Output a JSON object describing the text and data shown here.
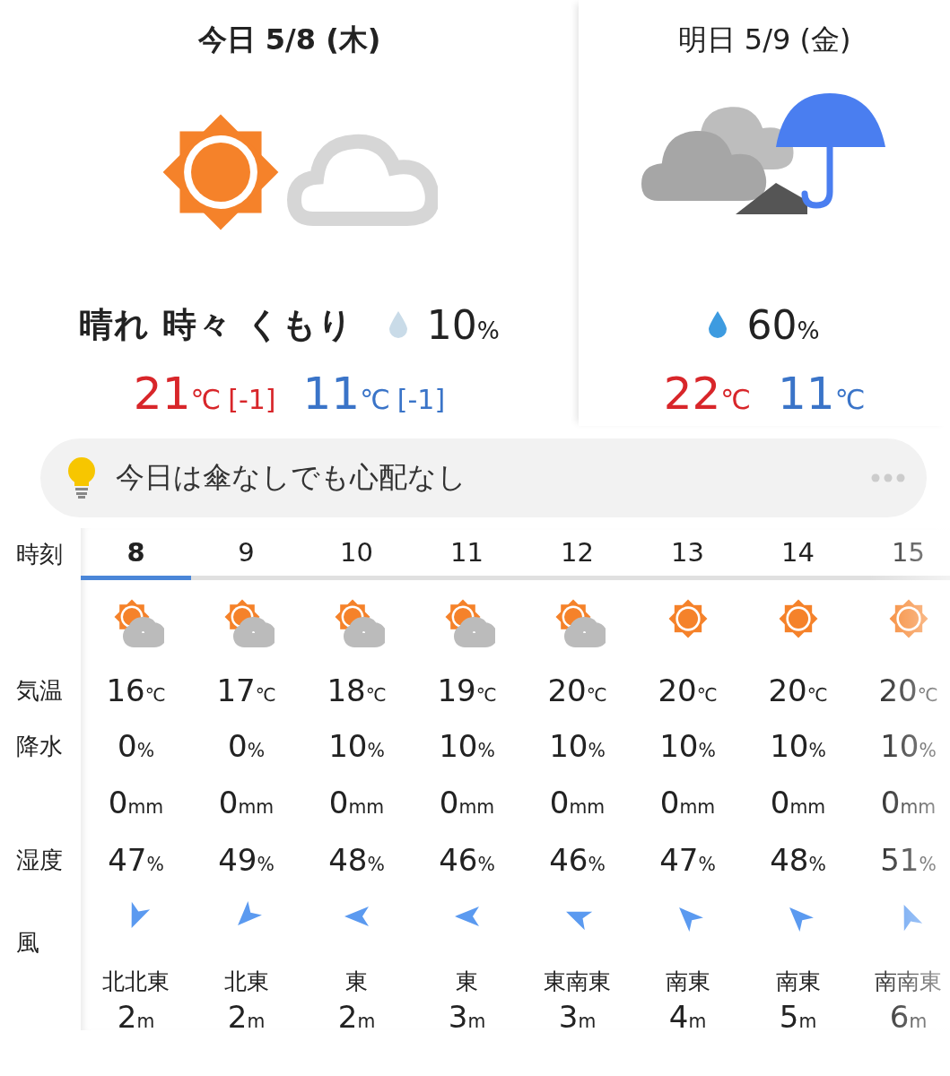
{
  "days": [
    {
      "label": "今日",
      "date": "5/8 (木)",
      "selected": true,
      "icon": {
        "kind": "sun_cloud"
      },
      "condition": "晴れ 時々 くもり",
      "rain": {
        "value": "10",
        "unit": "%",
        "color": "#c9dbe8"
      },
      "high": {
        "value": "21",
        "unit": "℃",
        "diff": "[-1]"
      },
      "low": {
        "value": "11",
        "unit": "℃",
        "diff": "[-1]"
      }
    },
    {
      "label": "明日",
      "date": "5/9 (金)",
      "selected": false,
      "icon": {
        "kind": "cloud_rain"
      },
      "rain": {
        "value": "60",
        "unit": "%",
        "color": "#3d9be0"
      },
      "high": {
        "value": "22",
        "unit": "℃"
      },
      "low": {
        "value": "11",
        "unit": "℃"
      }
    }
  ],
  "tip": {
    "text": "今日は傘なしでも心配なし"
  },
  "row_labels": {
    "time": "時刻",
    "temp": "気温",
    "precip": "降水",
    "humidity": "湿度",
    "wind": "風"
  },
  "hours": [
    {
      "time": "8",
      "selected": true,
      "icon": {
        "kind": "sun_cloud"
      },
      "temp": "16",
      "temp_unit": "℃",
      "precip": "0",
      "precip_unit": "%",
      "amount": "0",
      "amount_unit": "mm",
      "humidity": "47",
      "humidity_unit": "%",
      "wind": {
        "kind": "nne",
        "direction": "北北東",
        "speed": "2",
        "unit": "m"
      }
    },
    {
      "time": "9",
      "selected": false,
      "icon": {
        "kind": "sun_cloud"
      },
      "temp": "17",
      "temp_unit": "℃",
      "precip": "0",
      "precip_unit": "%",
      "amount": "0",
      "amount_unit": "mm",
      "humidity": "49",
      "humidity_unit": "%",
      "wind": {
        "kind": "ne",
        "direction": "北東",
        "speed": "2",
        "unit": "m"
      }
    },
    {
      "time": "10",
      "selected": false,
      "icon": {
        "kind": "sun_cloud"
      },
      "temp": "18",
      "temp_unit": "℃",
      "precip": "10",
      "precip_unit": "%",
      "amount": "0",
      "amount_unit": "mm",
      "humidity": "48",
      "humidity_unit": "%",
      "wind": {
        "kind": "e",
        "direction": "東",
        "speed": "2",
        "unit": "m"
      }
    },
    {
      "time": "11",
      "selected": false,
      "icon": {
        "kind": "sun_cloud"
      },
      "temp": "19",
      "temp_unit": "℃",
      "precip": "10",
      "precip_unit": "%",
      "amount": "0",
      "amount_unit": "mm",
      "humidity": "46",
      "humidity_unit": "%",
      "wind": {
        "kind": "e",
        "direction": "東",
        "speed": "3",
        "unit": "m"
      }
    },
    {
      "time": "12",
      "selected": false,
      "icon": {
        "kind": "sun_cloud"
      },
      "temp": "20",
      "temp_unit": "℃",
      "precip": "10",
      "precip_unit": "%",
      "amount": "0",
      "amount_unit": "mm",
      "humidity": "46",
      "humidity_unit": "%",
      "wind": {
        "kind": "ese",
        "direction": "東南東",
        "speed": "3",
        "unit": "m"
      }
    },
    {
      "time": "13",
      "selected": false,
      "icon": {
        "kind": "sun"
      },
      "temp": "20",
      "temp_unit": "℃",
      "precip": "10",
      "precip_unit": "%",
      "amount": "0",
      "amount_unit": "mm",
      "humidity": "47",
      "humidity_unit": "%",
      "wind": {
        "kind": "se",
        "direction": "南東",
        "speed": "4",
        "unit": "m"
      }
    },
    {
      "time": "14",
      "selected": false,
      "icon": {
        "kind": "sun"
      },
      "temp": "20",
      "temp_unit": "℃",
      "precip": "10",
      "precip_unit": "%",
      "amount": "0",
      "amount_unit": "mm",
      "humidity": "48",
      "humidity_unit": "%",
      "wind": {
        "kind": "se",
        "direction": "南東",
        "speed": "5",
        "unit": "m"
      }
    },
    {
      "time": "15",
      "selected": false,
      "icon": {
        "kind": "sun"
      },
      "temp": "20",
      "temp_unit": "℃",
      "precip": "10",
      "precip_unit": "%",
      "amount": "0",
      "amount_unit": "mm",
      "humidity": "51",
      "humidity_unit": "%",
      "wind": {
        "kind": "sse",
        "direction": "南南東",
        "speed": "6",
        "unit": "m"
      }
    }
  ]
}
